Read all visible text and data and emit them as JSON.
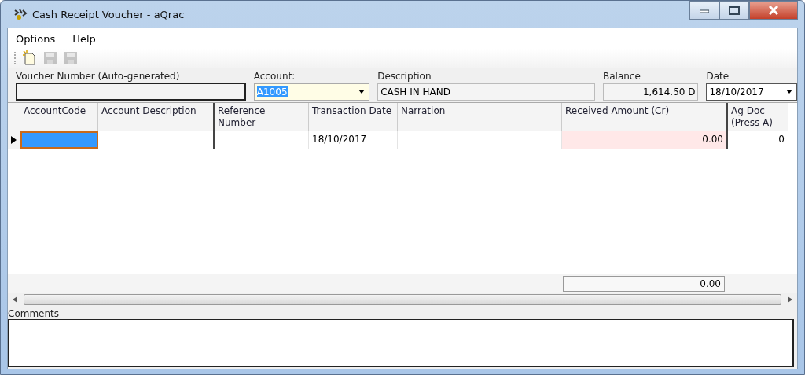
{
  "window": {
    "title": "Cash Receipt Voucher - aQrac"
  },
  "menu": [
    {
      "label": "Options"
    },
    {
      "label": "Help"
    }
  ],
  "toolbar": [
    {
      "kind": "new",
      "disabled": false
    },
    {
      "kind": "save",
      "disabled": true
    },
    {
      "kind": "save",
      "disabled": true
    }
  ],
  "header": {
    "voucher_number": {
      "label": "Voucher Number (Auto-generated)"
    },
    "account": {
      "label": "Account:",
      "value": "A1005"
    },
    "description": {
      "label": "Description",
      "value": "CASH IN HAND"
    },
    "balance": {
      "label": "Balance",
      "value": "1,614.50 D"
    },
    "date": {
      "label": "Date",
      "value": "18/10/2017"
    }
  },
  "table": {
    "columns": [
      "AccountCode",
      "Account Description",
      "Reference Number",
      "Transaction Date",
      "Narration",
      "Received Amount (Cr)",
      "Ag Doc (Press A)"
    ],
    "rows": [
      {
        "current": true,
        "cells": [
          "",
          "",
          "",
          "18/10/2017",
          "",
          "0.00",
          "0"
        ]
      }
    ],
    "total": "0.00"
  },
  "comments": {
    "label": "Comments"
  }
}
